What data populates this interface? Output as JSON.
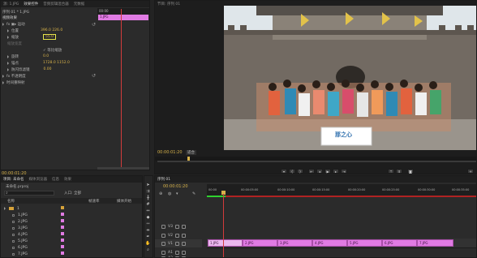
{
  "effects": {
    "tabs": [
      "源: 1.JPG",
      "效果控件",
      "音频剪辑混合器",
      "元数据"
    ],
    "clip_name": "序列 01 * 1.JPG",
    "section_title": "视频效果",
    "rows": [
      {
        "label": "fx  ▣▸ 运动",
        "value": ""
      },
      {
        "label": "位置",
        "value": "396.0    226.0"
      },
      {
        "label": "缩放",
        "value": "55.0"
      },
      {
        "label": "缩放宽度",
        "value": ""
      },
      {
        "label": "",
        "value": "✓ 等比缩放"
      },
      {
        "label": "旋转",
        "value": "0.0"
      },
      {
        "label": "锚点",
        "value": "1728.0   1152.0"
      },
      {
        "label": "防闪烁滤镜",
        "value": "0.00"
      },
      {
        "label": "fx  不透明度",
        "value": ""
      },
      {
        "label": "时间重映射",
        "value": ""
      }
    ],
    "mini_ruler_time": "00:00",
    "mini_clip_label": "1.JPG",
    "timecode": "00:00:01:20"
  },
  "program": {
    "tab": "节目: 序列 01",
    "timecode": "00:00:01:20",
    "fit": "适合",
    "photo_banner": "那之心"
  },
  "project": {
    "tabs": [
      "项目: 未命名",
      "媒体浏览器",
      "信息",
      "效果"
    ],
    "path": "未命名.prproj",
    "search_placeholder": "",
    "in_label": "入口: 全部",
    "columns": [
      "名称",
      "帧速率",
      "媒体开始"
    ],
    "items": [
      "1",
      "1.JPG",
      "2.JPG",
      "3.JPG",
      "4.JPG",
      "5.JPG",
      "6.JPG",
      "7.JPG"
    ]
  },
  "timeline": {
    "tab": "序列 01",
    "timecode": "00:00:01:20",
    "ruler_labels": [
      "00:00",
      "00:00:05:00",
      "00:00:10:00",
      "00:00:15:00",
      "00:00:20:00",
      "00:00:25:00",
      "00:00:30:00",
      "00:00:35:00"
    ],
    "tracks": [
      {
        "name": "V3"
      },
      {
        "name": "V2"
      },
      {
        "name": "V1"
      },
      {
        "name": "A1"
      },
      {
        "name": "A2"
      }
    ],
    "clips": [
      "1.JPG",
      "2.JPG",
      "3.JPG",
      "4.JPG",
      "5.JPG",
      "6.JPG",
      "7.JPG"
    ]
  },
  "colors": {
    "accent": "#d7b24a",
    "playhead": "#d23b3b",
    "clip": "#e07be3",
    "green_bar": "#2fd12f"
  }
}
